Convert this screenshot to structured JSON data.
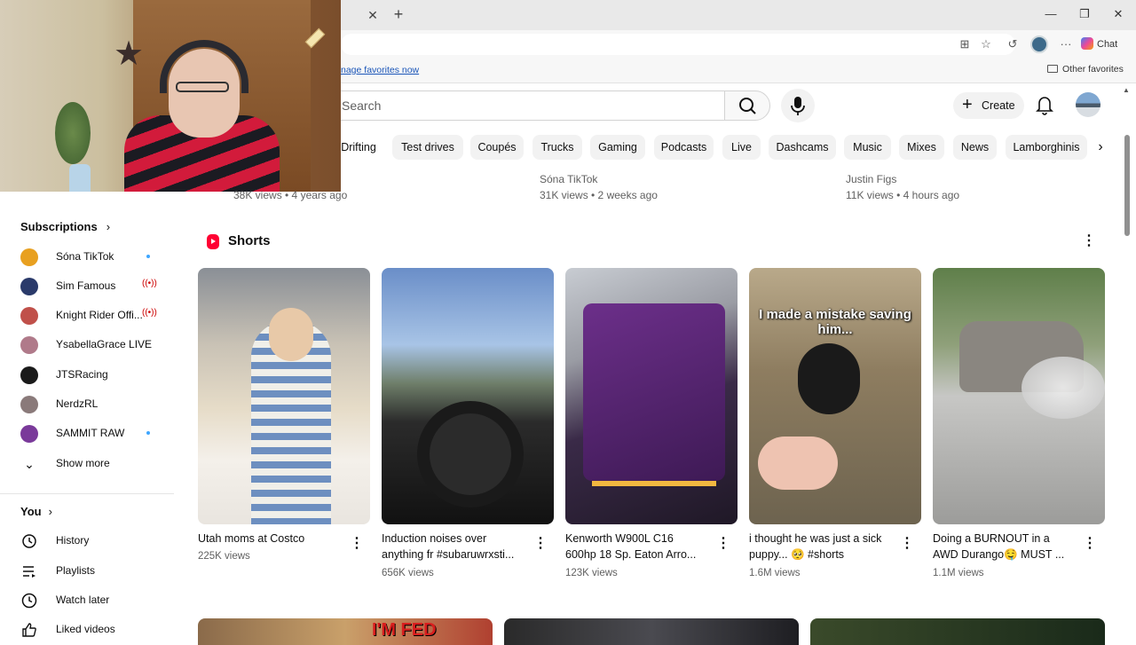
{
  "browser": {
    "favorites_link": "nage favorites now",
    "other_favorites": "Other favorites",
    "chat_label": "Chat"
  },
  "youtube": {
    "search_placeholder": "Search",
    "create_label": "Create",
    "chips": [
      "Drifting",
      "Test drives",
      "Coupés",
      "Trucks",
      "Gaming",
      "Podcasts",
      "Live",
      "Dashcams",
      "Music",
      "Mixes",
      "News",
      "Lamborghinis"
    ]
  },
  "sidebar": {
    "subscriptions_heading": "Subscriptions",
    "subscriptions": [
      {
        "name": "Sóna TikTok",
        "status": "new",
        "color": "#e8a020"
      },
      {
        "name": "Sim Famous",
        "status": "live",
        "color": "#2a3a6a"
      },
      {
        "name": "Knight Rider Offi...",
        "status": "live",
        "color": "#c0504a"
      },
      {
        "name": "YsabellaGrace LIVE",
        "status": "",
        "color": "#b07a8a"
      },
      {
        "name": "JTSRacing",
        "status": "",
        "color": "#1a1a1a"
      },
      {
        "name": "NerdzRL",
        "status": "",
        "color": "#8a7a7a"
      },
      {
        "name": "SAMMIT RAW",
        "status": "new",
        "color": "#7a3a9a"
      }
    ],
    "show_more": "Show more",
    "you_heading": "You",
    "you_items": [
      "History",
      "Playlists",
      "Watch later",
      "Liked videos"
    ]
  },
  "prev_row": [
    {
      "channel": "",
      "meta": "38K views • 4 years ago"
    },
    {
      "channel": "Sóna TikTok",
      "meta": "31K views • 2 weeks ago"
    },
    {
      "channel": "Justin Figs",
      "meta": "11K views • 4 hours ago"
    }
  ],
  "shorts": {
    "heading": "Shorts",
    "items": [
      {
        "title": "Utah moms at Costco",
        "views": "225K views"
      },
      {
        "title": "Induction noises over anything fr #subaruwrxsti...",
        "views": "656K views"
      },
      {
        "title": "Kenworth W900L C16 600hp 18 Sp. Eaton Arro...",
        "views": "123K views"
      },
      {
        "title": "i thought he was just a sick puppy... 🥺 #shorts",
        "views": "1.6M views",
        "overlay": "I made a mistake saving him..."
      },
      {
        "title": "Doing a BURNOUT in a AWD Durango🤤 MUST ...",
        "views": "1.1M views"
      }
    ]
  },
  "bottom_row": {
    "thumb1_text": "I'M FED"
  }
}
